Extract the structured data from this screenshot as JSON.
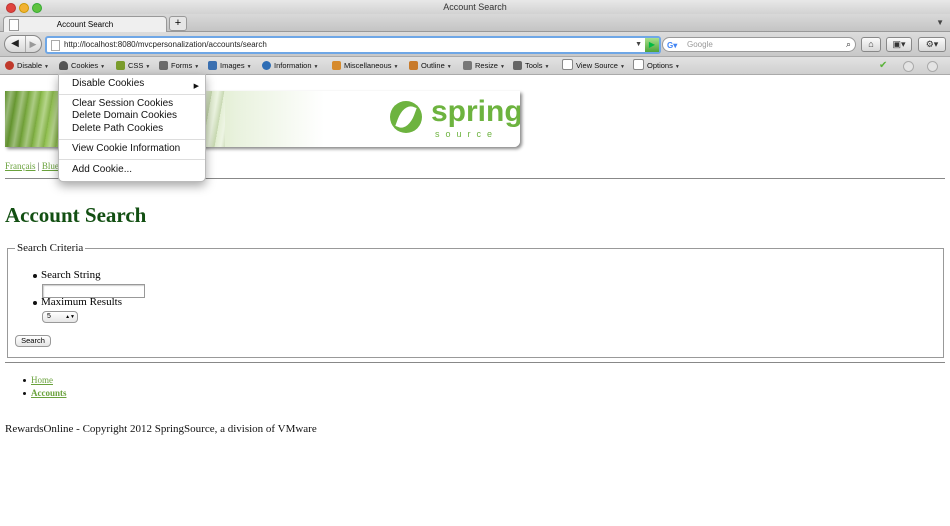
{
  "window": {
    "title": "Account Search"
  },
  "tabs": [
    {
      "label": "Account Search"
    }
  ],
  "toolbar": {
    "url": "http://localhost:8080/mvcpersonalization/accounts/search",
    "search_placeholder": "Google"
  },
  "devbar": {
    "items": [
      {
        "label": "Disable",
        "icon": "disable-icon",
        "color": "#c0392b"
      },
      {
        "label": "Cookies",
        "icon": "cookie-icon",
        "color": "#555555"
      },
      {
        "label": "CSS",
        "icon": "css-icon",
        "color": "#7a9c2c"
      },
      {
        "label": "Forms",
        "icon": "forms-icon",
        "color": "#6b6b6b"
      },
      {
        "label": "Images",
        "icon": "images-icon",
        "color": "#3a6fb0"
      },
      {
        "label": "Information",
        "icon": "information-icon",
        "color": "#2d6db5"
      },
      {
        "label": "Miscellaneous",
        "icon": "miscellaneous-icon",
        "color": "#d68a2c"
      },
      {
        "label": "Outline",
        "icon": "outline-icon",
        "color": "#c87a2a"
      },
      {
        "label": "Resize",
        "icon": "resize-icon",
        "color": "#777777"
      },
      {
        "label": "Tools",
        "icon": "tools-icon",
        "color": "#666666"
      },
      {
        "label": "View Source",
        "icon": "view-source-icon",
        "color": "#8a8a8a"
      },
      {
        "label": "Options",
        "icon": "options-icon",
        "color": "#8a8a8a"
      }
    ]
  },
  "cookies_menu": {
    "disable": "Disable Cookies",
    "clear_session": "Clear Session Cookies",
    "delete_domain": "Delete Domain Cookies",
    "delete_path": "Delete Path Cookies",
    "view_info": "View Cookie Information",
    "add": "Add Cookie..."
  },
  "page": {
    "banner_logo": "spring",
    "banner_sub": "source",
    "lang_links": [
      "Français",
      "Blue"
    ],
    "lang_separator": "|",
    "title": "Account Search",
    "form": {
      "legend": "Search Criteria",
      "search_string_label": "Search String",
      "search_string_value": "",
      "max_results_label": "Maximum Results",
      "max_results_value": "5",
      "submit": "Search"
    },
    "nav": [
      {
        "label": "Home"
      },
      {
        "label": "Accounts"
      }
    ],
    "footer": "RewardsOnline - Copyright 2012 SpringSource, a division of VMware"
  }
}
